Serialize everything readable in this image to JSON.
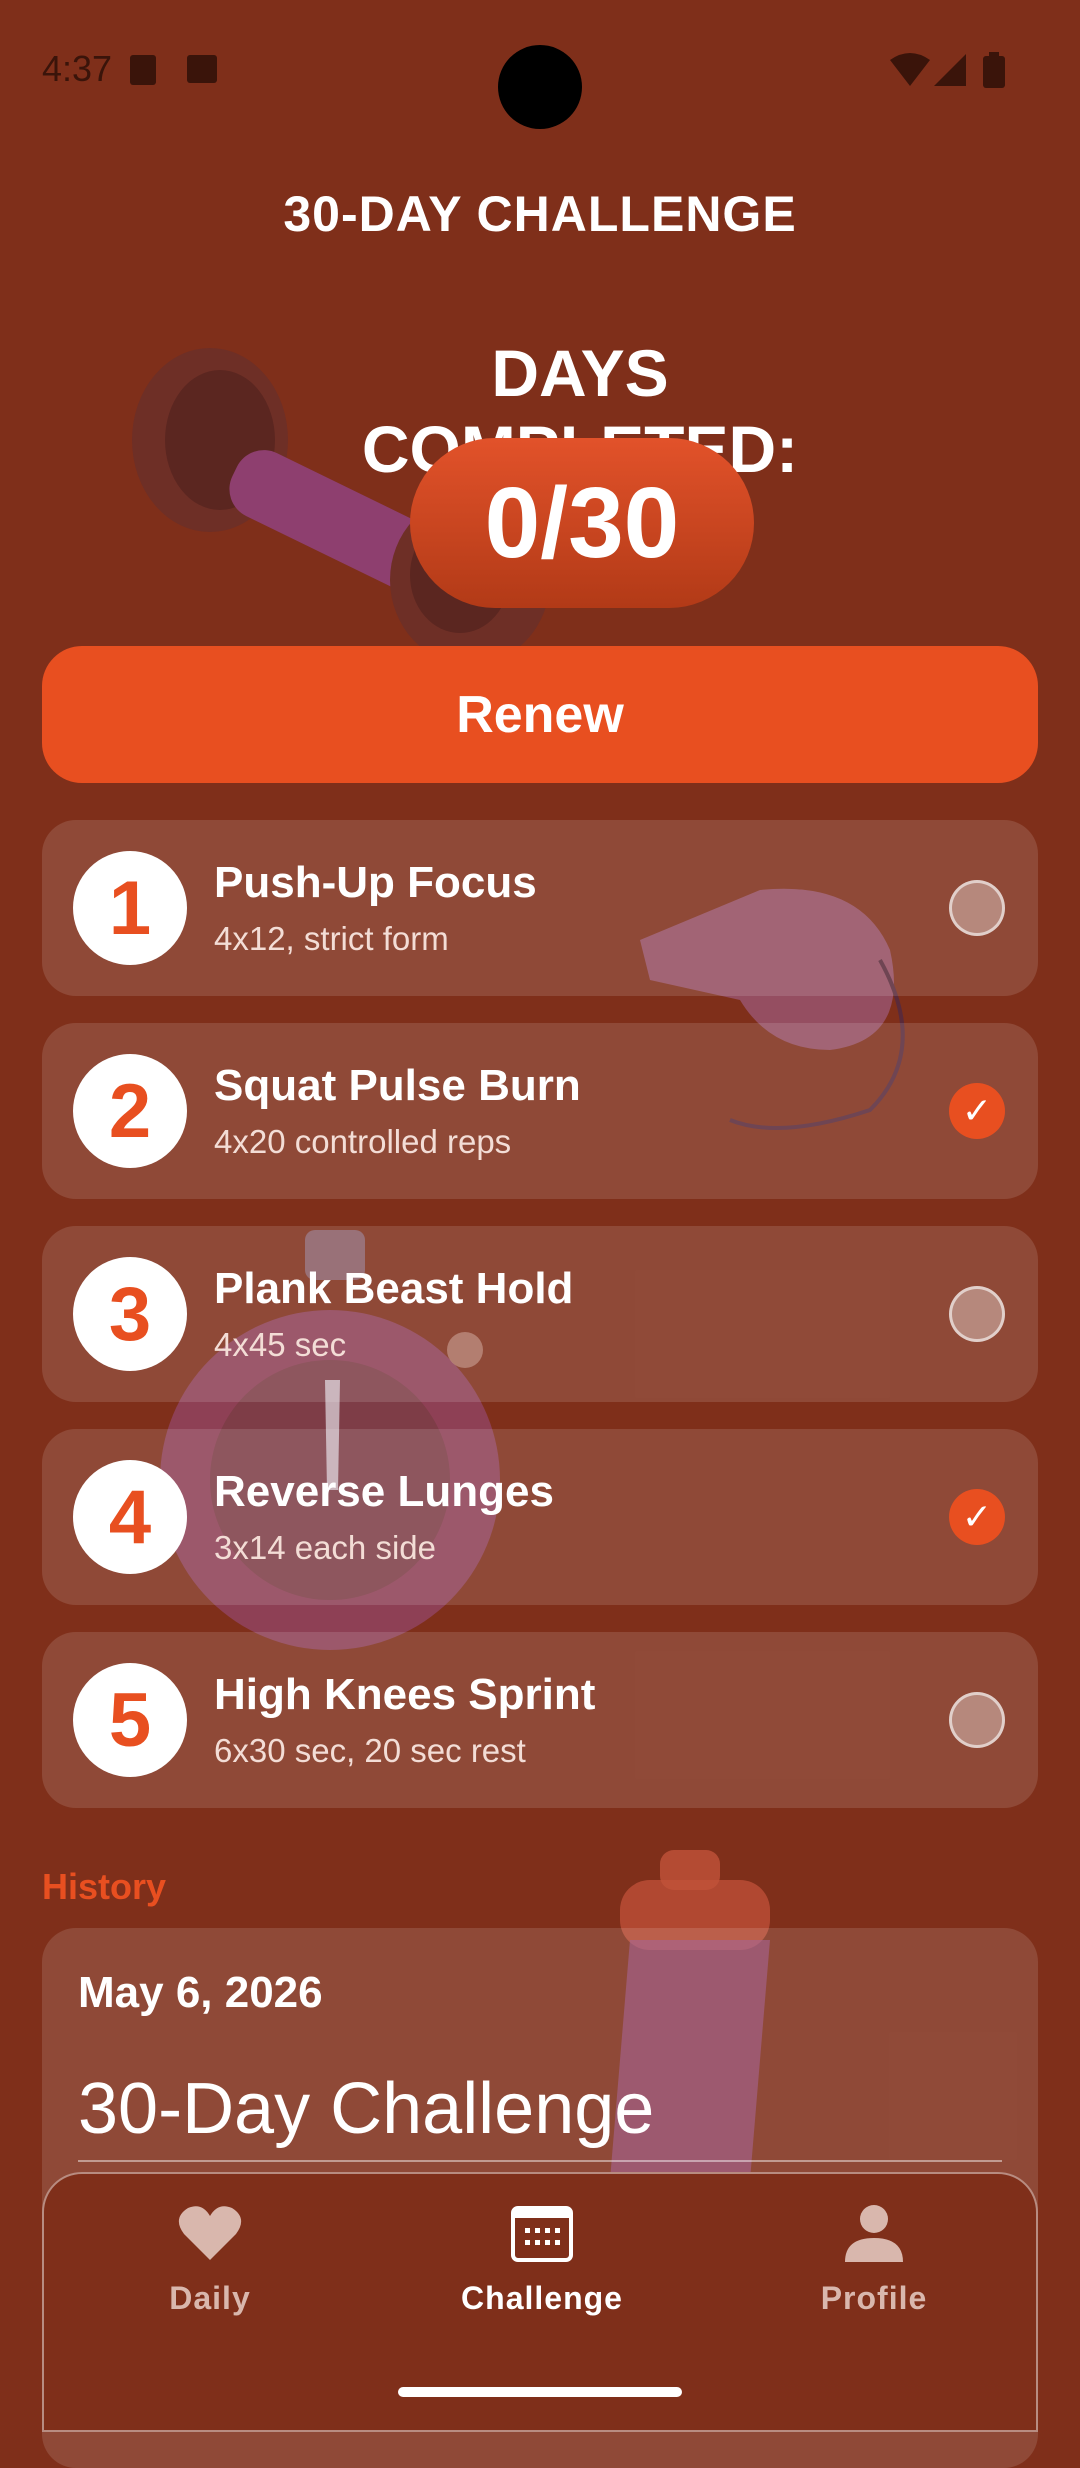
{
  "status": {
    "time": "4:37"
  },
  "header": {
    "title": "30-DAY CHALLENGE"
  },
  "progress": {
    "label": "DAYS COMPLETED:",
    "counter": "0/30",
    "completed": 0,
    "total": 30
  },
  "renew_label": "Renew",
  "exercises": [
    {
      "number": "1",
      "title": "Push-Up Focus",
      "detail": "4x12, strict form",
      "checked": false
    },
    {
      "number": "2",
      "title": "Squat Pulse Burn",
      "detail": "4x20 controlled reps",
      "checked": true
    },
    {
      "number": "3",
      "title": "Plank Beast Hold",
      "detail": "4x45 sec",
      "checked": false
    },
    {
      "number": "4",
      "title": "Reverse Lunges",
      "detail": "3x14 each side",
      "checked": true
    },
    {
      "number": "5",
      "title": "High Knees Sprint",
      "detail": "6x30 sec, 20 sec rest",
      "checked": false
    }
  ],
  "check_mark": "✓",
  "history": {
    "label": "History",
    "entry": {
      "date": "May 6, 2026",
      "name": "30-Day Challenge"
    }
  },
  "nav": {
    "items": [
      {
        "label": "Daily",
        "icon": "heart-icon",
        "active": false
      },
      {
        "label": "Challenge",
        "icon": "calendar-icon",
        "active": true
      },
      {
        "label": "Profile",
        "icon": "person-icon",
        "active": false
      }
    ]
  },
  "colors": {
    "background": "#7f2f1a",
    "accent": "#e84f20"
  }
}
